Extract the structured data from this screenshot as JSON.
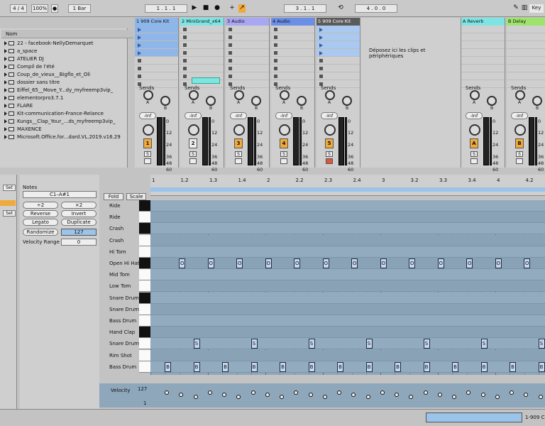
{
  "topbar": {
    "time_sig": "4 / 4",
    "zoom": "100%",
    "quantize": "1 Bar",
    "position": "1 .  1 .  1",
    "loop_start": "3 .  1 .  1",
    "loop_length": "4 .  0 .  0",
    "key_label": "Key"
  },
  "browser": {
    "header": "Nom",
    "items": [
      "22 - facebook-NellyDemarquet",
      "a_space",
      "ATELIER DJ",
      "Compil de l'été",
      "Coup_de_vieux__Bigflo_et_Oli",
      "dossier sans titre",
      "Eiffel_65__Move_Y...dy_myfreemp3vip_",
      "elementorpro3.7.1",
      "FLARE",
      "Kit-communication-France-Relance",
      "Kungs__Clap_Your_...ds_myfreemp3vip_",
      "MAXENCE",
      "Microsoft.Office.for...dard.VL.2019.v16.29"
    ]
  },
  "tracks": [
    {
      "name": "1 909 Core Kit",
      "color": "#8fb6e8",
      "number": "1",
      "number_color": "#f0a93b"
    },
    {
      "name": "2 MiniGrand_x64",
      "color": "#7fe4e4",
      "number": "2",
      "number_color": "#eeeeee"
    },
    {
      "name": "3 Audio",
      "color": "#a9a6f2",
      "number": "3",
      "number_color": "#f0a93b"
    },
    {
      "name": "4 Audio",
      "color": "#6b8ee6",
      "number": "4",
      "number_color": "#f0a93b"
    },
    {
      "name": "5 909 Core Kit",
      "color": "#5a5a5a",
      "number": "5",
      "number_color": "#f0a93b"
    }
  ],
  "drop_text": "Déposez ici les clips et périphériques",
  "returns": [
    {
      "name": "A Reverb",
      "color": "#7fe4e4",
      "letter": "A"
    },
    {
      "name": "B Delay",
      "color": "#9ee36b",
      "letter": "B"
    }
  ],
  "mixer": {
    "sends_label": "Sends",
    "send_a": "A",
    "send_b": "B",
    "inf_label": "-Inf",
    "db_marks": [
      "0",
      "12",
      "24",
      "36",
      "48",
      "60"
    ],
    "solo_label": "S"
  },
  "notes_panel": {
    "title": "Notes",
    "range": "C1–A#1",
    "div2": "÷2",
    "mul2": "×2",
    "reverse": "Reverse",
    "invert": "Invert",
    "legato": "Legato",
    "duplicate": "Duplicate",
    "randomize": "Randomize",
    "randomize_value": "127",
    "velocity_range_label": "Velocity Range",
    "velocity_range_value": "0",
    "set_label": "Set"
  },
  "pianoroll": {
    "fold": "Fold",
    "scale": "Scale",
    "ruler_marks": [
      "1",
      "1.2",
      "1.3",
      "1.4",
      "2",
      "2.2",
      "2.3",
      "2.4",
      "3",
      "3.2",
      "3.3",
      "3.4",
      "4",
      "4.2"
    ],
    "lanes": [
      "Ride",
      "Ride",
      "Crash",
      "Crash",
      "Hi Tom",
      "Open Hi Hat",
      "Mid Tom",
      "Low Tom",
      "Snare Drum",
      "Snare Drum",
      "Bass Drum",
      "Hand Clap",
      "Snare Drum",
      "Rim Shot",
      "Bass Drum"
    ],
    "black_keys": [
      0,
      2,
      5,
      8,
      11
    ],
    "note_letters": {
      "hihat": "O",
      "snare": "S",
      "kick": "B"
    },
    "hihat_steps": [
      1,
      3,
      5,
      7,
      9,
      11,
      13,
      15,
      17,
      19,
      21,
      23,
      25,
      27
    ],
    "snare_steps": [
      2,
      6,
      10,
      14,
      18,
      22,
      26
    ],
    "kick_steps": [
      0,
      2,
      4,
      6,
      8,
      10,
      12,
      14,
      16,
      18,
      20,
      22,
      24,
      26
    ]
  },
  "velocity": {
    "label": "Velocity",
    "max": "127",
    "min": "1"
  },
  "status": {
    "track_label": "1-909 C"
  }
}
